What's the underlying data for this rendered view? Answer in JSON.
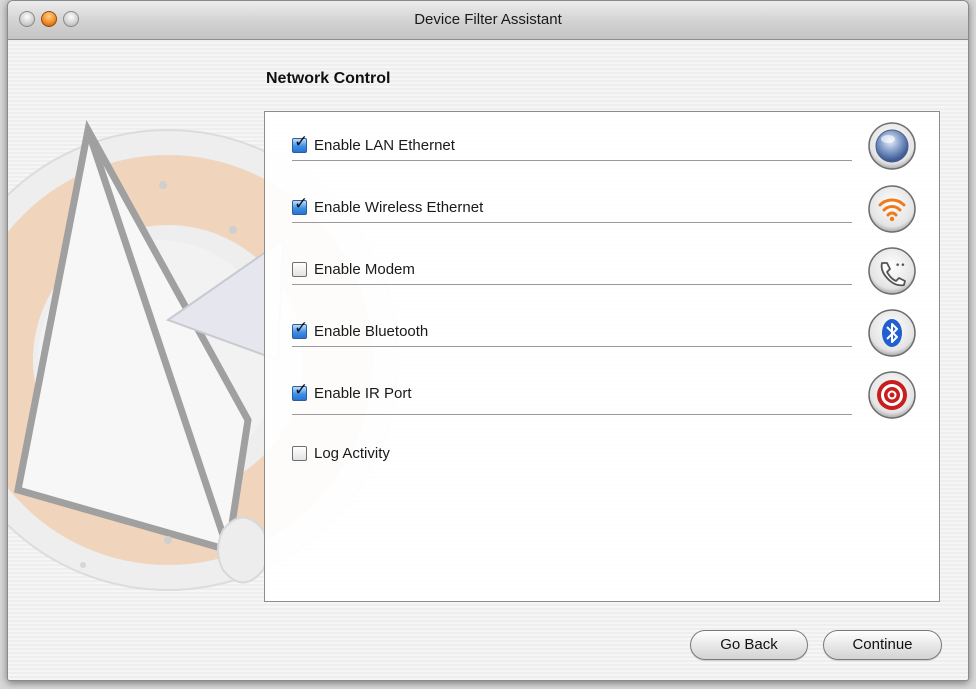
{
  "window": {
    "title": "Device Filter Assistant"
  },
  "section": {
    "title": "Network Control"
  },
  "options": [
    {
      "label": "Enable LAN Ethernet",
      "checked": true,
      "icon": "network-globe-icon"
    },
    {
      "label": "Enable Wireless Ethernet",
      "checked": true,
      "icon": "wifi-icon"
    },
    {
      "label": "Enable Modem",
      "checked": false,
      "icon": "modem-phone-icon"
    },
    {
      "label": "Enable Bluetooth",
      "checked": true,
      "icon": "bluetooth-icon"
    },
    {
      "label": "Enable IR Port",
      "checked": true,
      "icon": "ir-port-icon"
    },
    {
      "label": "Log Activity",
      "checked": false
    }
  ],
  "buttons": {
    "back": "Go Back",
    "continue": "Continue"
  },
  "colors": {
    "checkbox_checked": "#3d8fe6",
    "wifi_orange": "#f07a1a",
    "bluetooth_blue": "#1f5fd0",
    "ir_red": "#c81e1e"
  }
}
